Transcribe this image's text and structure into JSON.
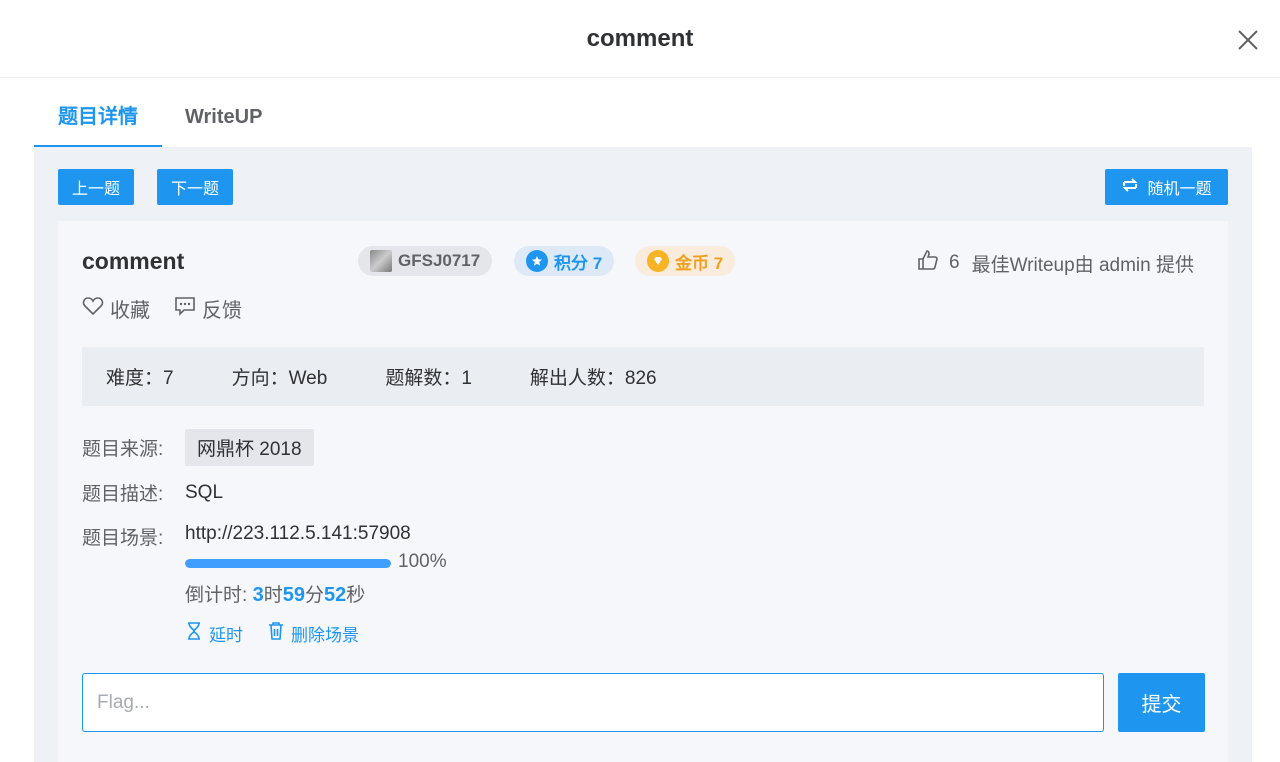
{
  "header": {
    "title": "comment"
  },
  "tabs": [
    {
      "label": "题目详情",
      "active": true
    },
    {
      "label": "WriteUP",
      "active": false
    }
  ],
  "nav": {
    "prev_label": "上一题",
    "next_label": "下一题",
    "random_label": "随机一题"
  },
  "challenge": {
    "title": "comment",
    "code": "GFSJ0717",
    "score_label": "积分 7",
    "coin_label": "金币 7",
    "likes": "6",
    "writeup_credit": "最佳Writeup由 admin 提供",
    "favorite_label": "收藏",
    "feedback_label": "反馈"
  },
  "stats": {
    "difficulty": "难度：7",
    "direction": "方向：Web",
    "writeups": "题解数：1",
    "solvers": "解出人数：826"
  },
  "details": {
    "source_label": "题目来源:",
    "source_value": "网鼎杯 2018",
    "description_label": "题目描述:",
    "description_value": "SQL",
    "scene_label": "题目场景:",
    "scene_url": "http://223.112.5.141:57908",
    "progress_percent": 100,
    "progress_text": "100%",
    "countdown_prefix": "倒计时: ",
    "countdown_h": "3",
    "countdown_h_unit": "时",
    "countdown_m": "59",
    "countdown_m_unit": "分",
    "countdown_s": "52",
    "countdown_s_unit": "秒",
    "extend_label": "延时",
    "delete_label": "删除场景"
  },
  "flag": {
    "placeholder": "Flag...",
    "value": "",
    "submit_label": "提交"
  },
  "colors": {
    "accent": "#1e96f0",
    "coin": "#f0a020"
  }
}
